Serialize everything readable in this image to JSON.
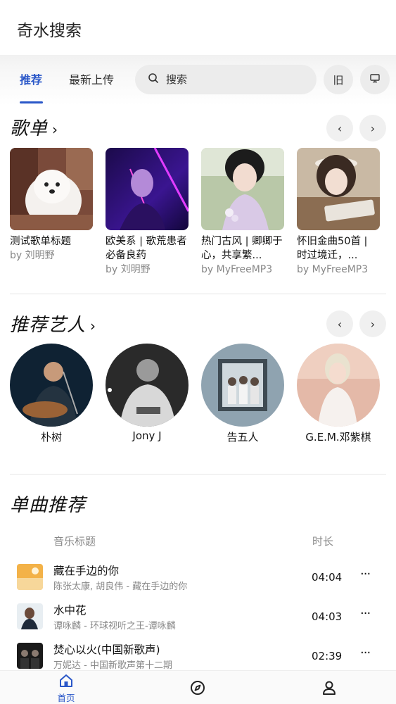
{
  "app": {
    "title": "奇水搜索"
  },
  "tabs": [
    {
      "label": "推荐",
      "active": true
    },
    {
      "label": "最新上传",
      "active": false
    }
  ],
  "search": {
    "placeholder": "搜索",
    "icon": "search-icon"
  },
  "header_buttons": [
    {
      "label": "旧",
      "name": "old-version-button"
    },
    {
      "icon": "monitor-icon",
      "name": "desktop-button"
    }
  ],
  "playlists": {
    "title": "歌单",
    "items": [
      {
        "title": "测试歌单标题",
        "sub": "by 刘明野"
      },
      {
        "title": "欧美系 | 歌荒患者必备良药",
        "sub": "by 刘明野"
      },
      {
        "title": "热门古风 | 卿卿于心，共享繁...",
        "sub": "by MyFreeMP3"
      },
      {
        "title": "怀旧金曲50首 | 时过境迁，...",
        "sub": "by MyFreeMP3"
      }
    ]
  },
  "artists": {
    "title": "推荐艺人",
    "items": [
      {
        "name": "朴树"
      },
      {
        "name": "Jony J"
      },
      {
        "name": "告五人"
      },
      {
        "name": "G.E.M.邓紫棋"
      }
    ]
  },
  "songs": {
    "title": "单曲推荐",
    "col_title": "音乐标题",
    "col_duration": "时长",
    "items": [
      {
        "title": "藏在手边的你",
        "sub": "陈张太康, 胡良伟 - 藏在手边的你",
        "duration": "04:04",
        "more": "···"
      },
      {
        "title": "水中花",
        "sub": "谭咏麟 - 环球视听之王-谭咏麟",
        "duration": "04:03",
        "more": "···"
      },
      {
        "title": "焚心以火(中国新歌声)",
        "sub": "万妮达 - 中国新歌声第十二期",
        "duration": "02:39",
        "more": "···"
      }
    ]
  },
  "bottom_nav": [
    {
      "label": "首页",
      "icon": "home-icon",
      "active": true
    },
    {
      "label": "",
      "icon": "compass-icon",
      "active": false
    },
    {
      "label": "",
      "icon": "user-icon",
      "active": false
    }
  ],
  "colors": {
    "accent": "#2a57c8",
    "muted": "#888888"
  }
}
